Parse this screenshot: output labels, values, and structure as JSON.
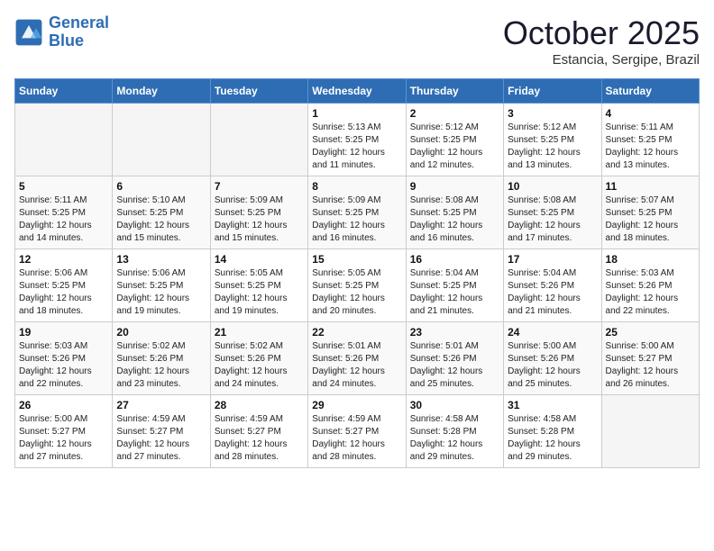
{
  "header": {
    "logo_line1": "General",
    "logo_line2": "Blue",
    "month": "October 2025",
    "location": "Estancia, Sergipe, Brazil"
  },
  "weekdays": [
    "Sunday",
    "Monday",
    "Tuesday",
    "Wednesday",
    "Thursday",
    "Friday",
    "Saturday"
  ],
  "weeks": [
    [
      {
        "num": "",
        "info": ""
      },
      {
        "num": "",
        "info": ""
      },
      {
        "num": "",
        "info": ""
      },
      {
        "num": "1",
        "info": "Sunrise: 5:13 AM\nSunset: 5:25 PM\nDaylight: 12 hours\nand 11 minutes."
      },
      {
        "num": "2",
        "info": "Sunrise: 5:12 AM\nSunset: 5:25 PM\nDaylight: 12 hours\nand 12 minutes."
      },
      {
        "num": "3",
        "info": "Sunrise: 5:12 AM\nSunset: 5:25 PM\nDaylight: 12 hours\nand 13 minutes."
      },
      {
        "num": "4",
        "info": "Sunrise: 5:11 AM\nSunset: 5:25 PM\nDaylight: 12 hours\nand 13 minutes."
      }
    ],
    [
      {
        "num": "5",
        "info": "Sunrise: 5:11 AM\nSunset: 5:25 PM\nDaylight: 12 hours\nand 14 minutes."
      },
      {
        "num": "6",
        "info": "Sunrise: 5:10 AM\nSunset: 5:25 PM\nDaylight: 12 hours\nand 15 minutes."
      },
      {
        "num": "7",
        "info": "Sunrise: 5:09 AM\nSunset: 5:25 PM\nDaylight: 12 hours\nand 15 minutes."
      },
      {
        "num": "8",
        "info": "Sunrise: 5:09 AM\nSunset: 5:25 PM\nDaylight: 12 hours\nand 16 minutes."
      },
      {
        "num": "9",
        "info": "Sunrise: 5:08 AM\nSunset: 5:25 PM\nDaylight: 12 hours\nand 16 minutes."
      },
      {
        "num": "10",
        "info": "Sunrise: 5:08 AM\nSunset: 5:25 PM\nDaylight: 12 hours\nand 17 minutes."
      },
      {
        "num": "11",
        "info": "Sunrise: 5:07 AM\nSunset: 5:25 PM\nDaylight: 12 hours\nand 18 minutes."
      }
    ],
    [
      {
        "num": "12",
        "info": "Sunrise: 5:06 AM\nSunset: 5:25 PM\nDaylight: 12 hours\nand 18 minutes."
      },
      {
        "num": "13",
        "info": "Sunrise: 5:06 AM\nSunset: 5:25 PM\nDaylight: 12 hours\nand 19 minutes."
      },
      {
        "num": "14",
        "info": "Sunrise: 5:05 AM\nSunset: 5:25 PM\nDaylight: 12 hours\nand 19 minutes."
      },
      {
        "num": "15",
        "info": "Sunrise: 5:05 AM\nSunset: 5:25 PM\nDaylight: 12 hours\nand 20 minutes."
      },
      {
        "num": "16",
        "info": "Sunrise: 5:04 AM\nSunset: 5:25 PM\nDaylight: 12 hours\nand 21 minutes."
      },
      {
        "num": "17",
        "info": "Sunrise: 5:04 AM\nSunset: 5:26 PM\nDaylight: 12 hours\nand 21 minutes."
      },
      {
        "num": "18",
        "info": "Sunrise: 5:03 AM\nSunset: 5:26 PM\nDaylight: 12 hours\nand 22 minutes."
      }
    ],
    [
      {
        "num": "19",
        "info": "Sunrise: 5:03 AM\nSunset: 5:26 PM\nDaylight: 12 hours\nand 22 minutes."
      },
      {
        "num": "20",
        "info": "Sunrise: 5:02 AM\nSunset: 5:26 PM\nDaylight: 12 hours\nand 23 minutes."
      },
      {
        "num": "21",
        "info": "Sunrise: 5:02 AM\nSunset: 5:26 PM\nDaylight: 12 hours\nand 24 minutes."
      },
      {
        "num": "22",
        "info": "Sunrise: 5:01 AM\nSunset: 5:26 PM\nDaylight: 12 hours\nand 24 minutes."
      },
      {
        "num": "23",
        "info": "Sunrise: 5:01 AM\nSunset: 5:26 PM\nDaylight: 12 hours\nand 25 minutes."
      },
      {
        "num": "24",
        "info": "Sunrise: 5:00 AM\nSunset: 5:26 PM\nDaylight: 12 hours\nand 25 minutes."
      },
      {
        "num": "25",
        "info": "Sunrise: 5:00 AM\nSunset: 5:27 PM\nDaylight: 12 hours\nand 26 minutes."
      }
    ],
    [
      {
        "num": "26",
        "info": "Sunrise: 5:00 AM\nSunset: 5:27 PM\nDaylight: 12 hours\nand 27 minutes."
      },
      {
        "num": "27",
        "info": "Sunrise: 4:59 AM\nSunset: 5:27 PM\nDaylight: 12 hours\nand 27 minutes."
      },
      {
        "num": "28",
        "info": "Sunrise: 4:59 AM\nSunset: 5:27 PM\nDaylight: 12 hours\nand 28 minutes."
      },
      {
        "num": "29",
        "info": "Sunrise: 4:59 AM\nSunset: 5:27 PM\nDaylight: 12 hours\nand 28 minutes."
      },
      {
        "num": "30",
        "info": "Sunrise: 4:58 AM\nSunset: 5:28 PM\nDaylight: 12 hours\nand 29 minutes."
      },
      {
        "num": "31",
        "info": "Sunrise: 4:58 AM\nSunset: 5:28 PM\nDaylight: 12 hours\nand 29 minutes."
      },
      {
        "num": "",
        "info": ""
      }
    ]
  ]
}
